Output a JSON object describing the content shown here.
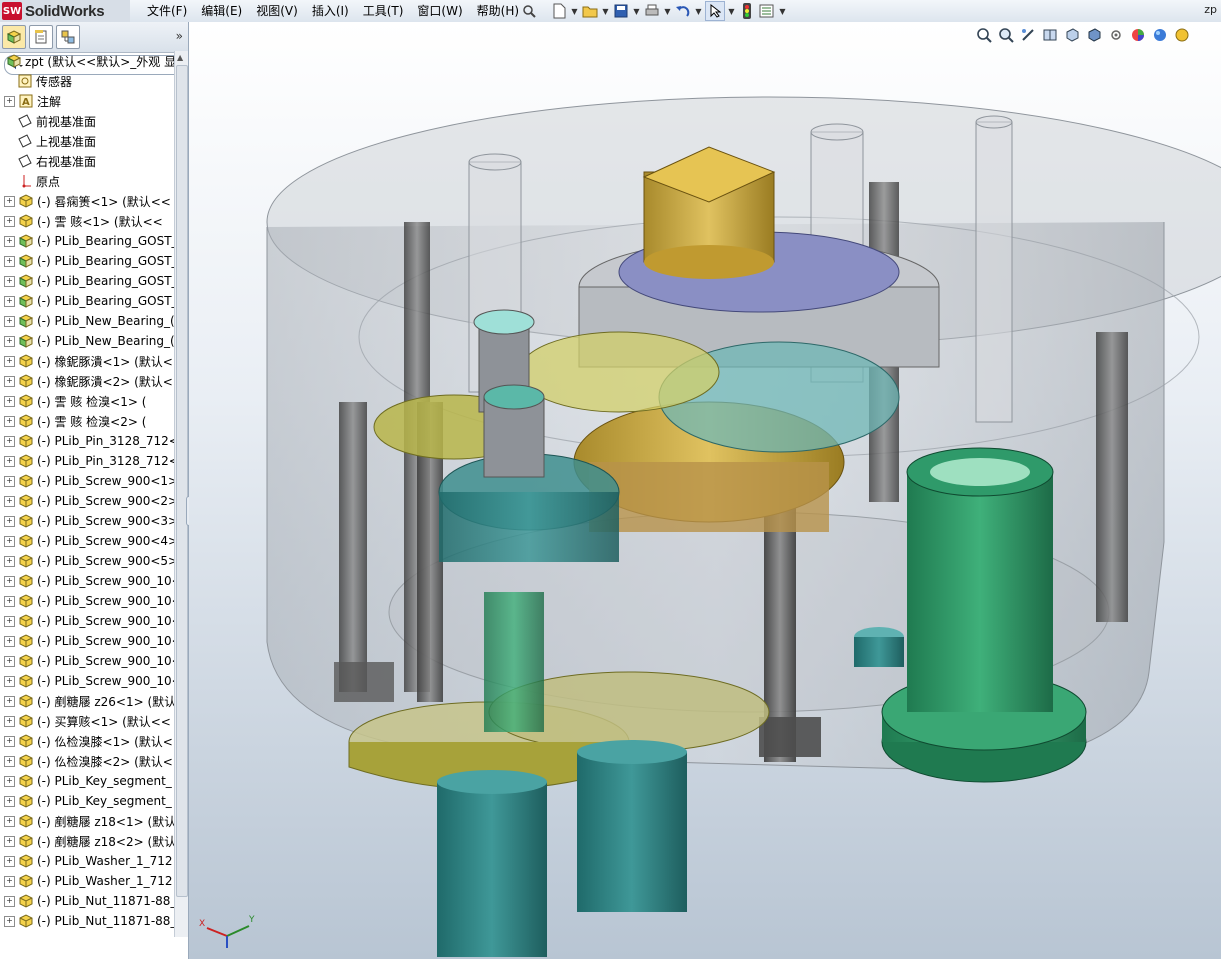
{
  "app": {
    "logo_badge": "SW",
    "logo_text": "SolidWorks",
    "corner_title": "zp"
  },
  "menu": [
    "文件(F)",
    "编辑(E)",
    "视图(V)",
    "插入(I)",
    "工具(T)",
    "窗口(W)",
    "帮助(H)"
  ],
  "panel": {
    "tabs": [
      "feature-manager",
      "property-manager",
      "configuration-manager"
    ],
    "expand_label": "»",
    "root_label": "zpt (默认<<默认>_外观 显",
    "items": [
      {
        "label": "传感器",
        "icon": "sensor-icon",
        "expandable": false
      },
      {
        "label": "注解",
        "icon": "annotation-icon",
        "expandable": true
      },
      {
        "label": "前视基准面",
        "icon": "plane-icon",
        "expandable": false
      },
      {
        "label": "上视基准面",
        "icon": "plane-icon",
        "expandable": false
      },
      {
        "label": "右视基准面",
        "icon": "plane-icon",
        "expandable": false
      },
      {
        "label": "原点",
        "icon": "origin-icon",
        "expandable": false
      },
      {
        "label": "(-) 晷痫箦<1> (默认<<",
        "icon": "part-icon",
        "expandable": true
      },
      {
        "label": "(-) 霅   赅<1> (默认<<",
        "icon": "part-icon",
        "expandable": true
      },
      {
        "label": "(-) PLib_Bearing_GOST_",
        "icon": "subassembly-icon",
        "expandable": true
      },
      {
        "label": "(-) PLib_Bearing_GOST_",
        "icon": "subassembly-icon",
        "expandable": true
      },
      {
        "label": "(-) PLib_Bearing_GOST_",
        "icon": "subassembly-icon",
        "expandable": true
      },
      {
        "label": "(-) PLib_Bearing_GOST_",
        "icon": "subassembly-icon",
        "expandable": true
      },
      {
        "label": "(-) PLib_New_Bearing_(",
        "icon": "subassembly-icon",
        "expandable": true
      },
      {
        "label": "(-) PLib_New_Bearing_(",
        "icon": "subassembly-icon",
        "expandable": true
      },
      {
        "label": "(-) 橡鈮豚潰<1> (默认<",
        "icon": "part-icon",
        "expandable": true
      },
      {
        "label": "(-) 橡鈮豚潰<2> (默认<",
        "icon": "part-icon",
        "expandable": true
      },
      {
        "label": "(-) 霅   赅    检溴<1> (",
        "icon": "part-icon",
        "expandable": true
      },
      {
        "label": "(-) 霅   赅    检溴<2> (",
        "icon": "part-icon",
        "expandable": true
      },
      {
        "label": "(-) PLib_Pin_3128_712<",
        "icon": "part-icon",
        "expandable": true
      },
      {
        "label": "(-) PLib_Pin_3128_712<",
        "icon": "part-icon",
        "expandable": true
      },
      {
        "label": "(-) PLib_Screw_900<1>",
        "icon": "part-icon",
        "expandable": true
      },
      {
        "label": "(-) PLib_Screw_900<2>",
        "icon": "part-icon",
        "expandable": true
      },
      {
        "label": "(-) PLib_Screw_900<3>",
        "icon": "part-icon",
        "expandable": true
      },
      {
        "label": "(-) PLib_Screw_900<4>",
        "icon": "part-icon",
        "expandable": true
      },
      {
        "label": "(-) PLib_Screw_900<5>",
        "icon": "part-icon",
        "expandable": true
      },
      {
        "label": "(-) PLib_Screw_900_10<",
        "icon": "part-icon",
        "expandable": true
      },
      {
        "label": "(-) PLib_Screw_900_10<",
        "icon": "part-icon",
        "expandable": true
      },
      {
        "label": "(-) PLib_Screw_900_10<",
        "icon": "part-icon",
        "expandable": true
      },
      {
        "label": "(-) PLib_Screw_900_10<",
        "icon": "part-icon",
        "expandable": true
      },
      {
        "label": "(-) PLib_Screw_900_10<",
        "icon": "part-icon",
        "expandable": true
      },
      {
        "label": "(-) PLib_Screw_900_10<",
        "icon": "part-icon",
        "expandable": true
      },
      {
        "label": "(-) 剷糖屦 z26<1> (默认",
        "icon": "part-icon",
        "expandable": true
      },
      {
        "label": "(-) 买算赅<1> (默认<<",
        "icon": "part-icon",
        "expandable": true
      },
      {
        "label": "(-) 仫检溴膝<1> (默认<",
        "icon": "part-icon",
        "expandable": true
      },
      {
        "label": "(-) 仫检溴膝<2> (默认<",
        "icon": "part-icon",
        "expandable": true
      },
      {
        "label": "(-) PLib_Key_segment_",
        "icon": "part-icon",
        "expandable": true
      },
      {
        "label": "(-) PLib_Key_segment_",
        "icon": "part-icon",
        "expandable": true
      },
      {
        "label": "(-) 剷糖屦 z18<1> (默认",
        "icon": "part-icon",
        "expandable": true
      },
      {
        "label": "(-) 剷糖屦 z18<2> (默认",
        "icon": "part-icon",
        "expandable": true
      },
      {
        "label": "(-) PLib_Washer_1_712",
        "icon": "part-icon",
        "expandable": true
      },
      {
        "label": "(-) PLib_Washer_1_712",
        "icon": "part-icon",
        "expandable": true
      },
      {
        "label": "(-) PLib_Nut_11871-88_",
        "icon": "part-icon",
        "expandable": true
      },
      {
        "label": "(-) PLib_Nut_11871-88_",
        "icon": "part-icon",
        "expandable": true
      }
    ]
  },
  "triad": {
    "x": "X",
    "y": "Y"
  },
  "colors": {
    "housing": "#b9bcc2",
    "gear_gold": "#c9a74a",
    "gear_teal": "#3a8f8f",
    "green": "#2f9a6a",
    "olive": "#a7a23a",
    "blue_plate": "#8a8fc4"
  }
}
